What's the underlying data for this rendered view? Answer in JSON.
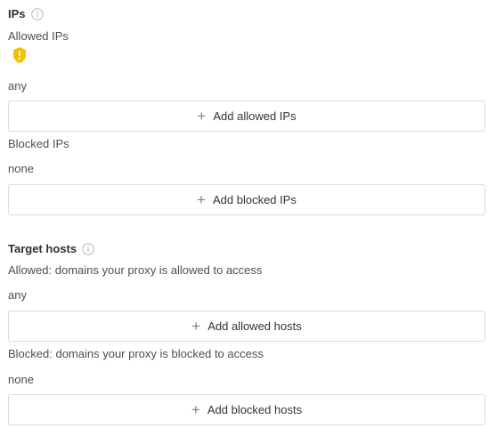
{
  "ips": {
    "heading": "IPs",
    "allowed_label": "Allowed IPs",
    "allowed_value": "any",
    "add_allowed_label": "Add allowed IPs",
    "blocked_label": "Blocked IPs",
    "blocked_value": "none",
    "add_blocked_label": "Add blocked IPs"
  },
  "target_hosts": {
    "heading": "Target hosts",
    "allowed_label": "Allowed: domains your proxy is allowed to access",
    "allowed_value": "any",
    "add_allowed_label": "Add allowed hosts",
    "blocked_label": "Blocked: domains your proxy is blocked to access",
    "blocked_value": "none",
    "add_blocked_label": "Add blocked hosts"
  },
  "icons": {
    "info": "info-icon",
    "warning": "shield-warning-icon",
    "plus": "plus-icon"
  },
  "colors": {
    "warning": "#f2c200",
    "border": "#d9dce1"
  }
}
